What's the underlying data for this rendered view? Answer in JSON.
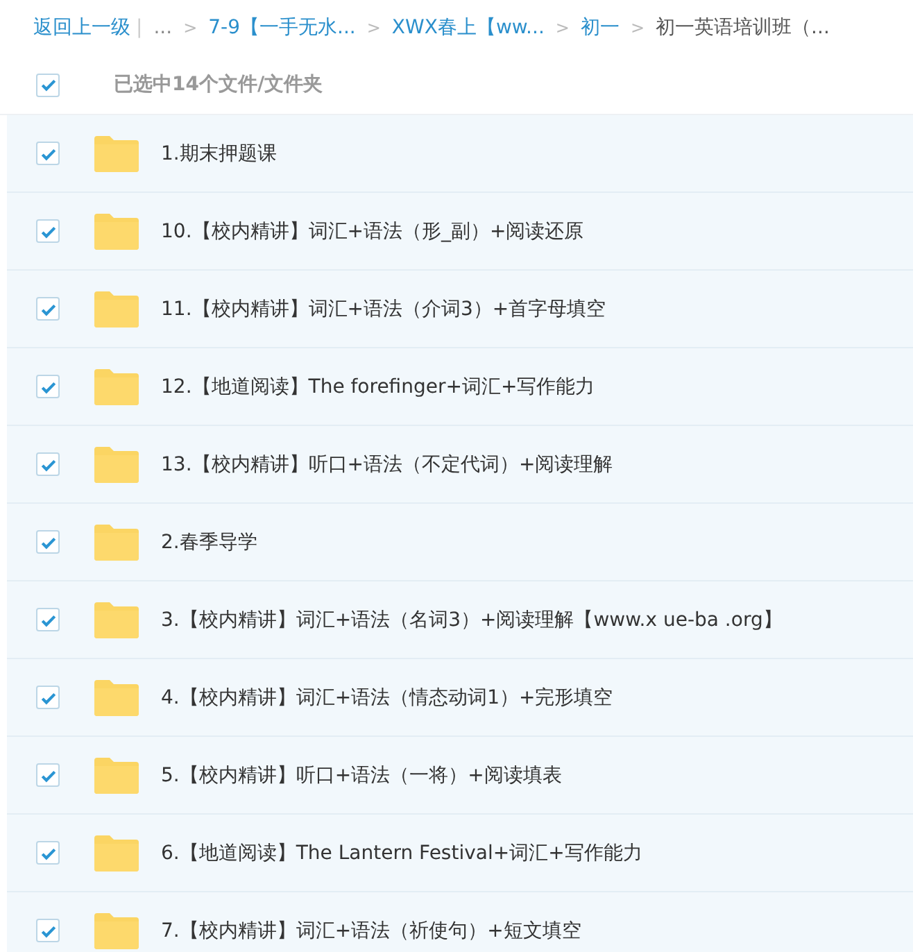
{
  "breadcrumb": [
    {
      "kind": "link",
      "label": "返回上一级"
    },
    {
      "kind": "divider",
      "label": "|"
    },
    {
      "kind": "plain",
      "label": "..."
    },
    {
      "kind": "sep",
      "label": ">"
    },
    {
      "kind": "link",
      "label": "7-9【一手无水..."
    },
    {
      "kind": "sep",
      "label": ">"
    },
    {
      "kind": "link",
      "label": "XWX春上【ww..."
    },
    {
      "kind": "sep",
      "label": ">"
    },
    {
      "kind": "link",
      "label": "初一"
    },
    {
      "kind": "sep",
      "label": ">"
    },
    {
      "kind": "current",
      "label": "初一英语培训班（..."
    }
  ],
  "header": {
    "checked": true,
    "label": "已选中14个文件/文件夹"
  },
  "files": [
    {
      "name": "1.期末押题课",
      "checked": true
    },
    {
      "name": "10.【校内精讲】词汇+语法（形_副）+阅读还原",
      "checked": true
    },
    {
      "name": "11.【校内精讲】词汇+语法（介词3）+首字母填空",
      "checked": true
    },
    {
      "name": "12.【地道阅读】The forefinger+词汇+写作能力",
      "checked": true
    },
    {
      "name": "13.【校内精讲】听口+语法（不定代词）+阅读理解",
      "checked": true
    },
    {
      "name": "2.春季导学",
      "checked": true
    },
    {
      "name": "3.【校内精讲】词汇+语法（名词3）+阅读理解【www.x ue-ba .org】",
      "checked": true
    },
    {
      "name": "4.【校内精讲】词汇+语法（情态动词1）+完形填空",
      "checked": true
    },
    {
      "name": "5.【校内精讲】听口+语法（一将）+阅读填表",
      "checked": true
    },
    {
      "name": "6.【地道阅读】The Lantern Festival+词汇+写作能力",
      "checked": true
    },
    {
      "name": "7.【校内精讲】词汇+语法（祈使句）+短文填空",
      "checked": true
    }
  ]
}
